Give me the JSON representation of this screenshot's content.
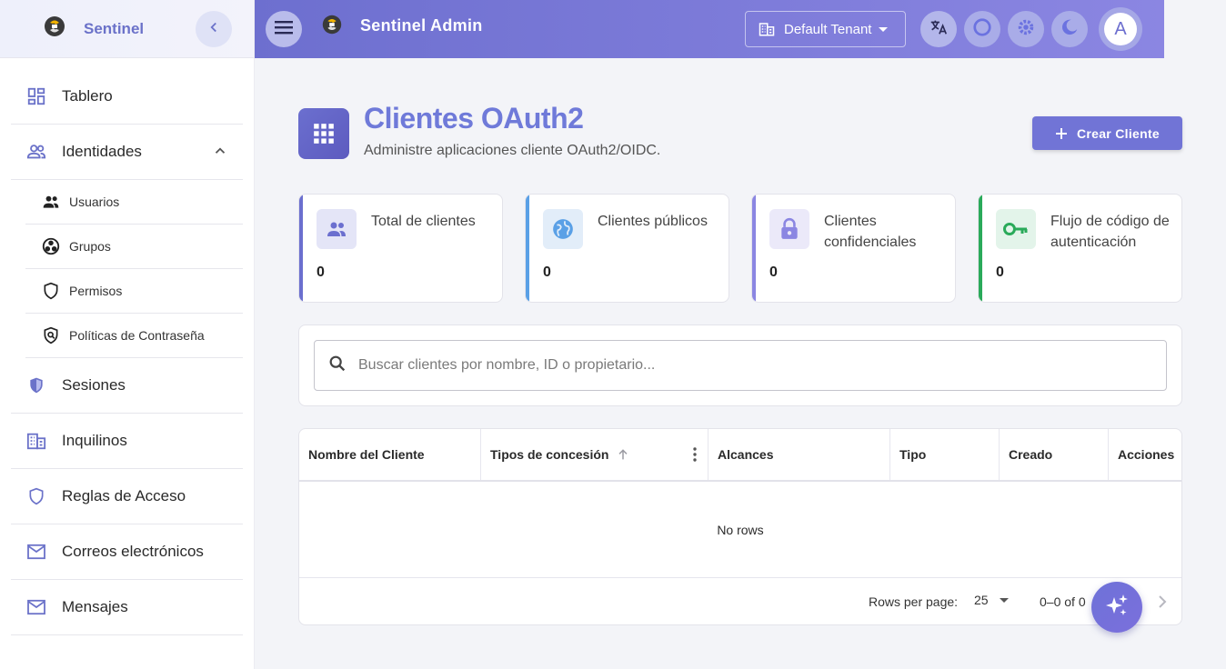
{
  "sidebar": {
    "brand": "Sentinel",
    "items": [
      {
        "label": "Tablero",
        "icon": "dashboard-icon"
      },
      {
        "label": "Identidades",
        "icon": "people-outline-icon",
        "expanded": true
      },
      {
        "label": "Sesiones",
        "icon": "shield-half-icon"
      },
      {
        "label": "Inquilinos",
        "icon": "building-icon"
      },
      {
        "label": "Reglas de Acceso",
        "icon": "shield-outline-icon"
      },
      {
        "label": "Correos electrónicos",
        "icon": "mail-icon"
      },
      {
        "label": "Mensajes",
        "icon": "mail-icon"
      }
    ],
    "sub_items": [
      {
        "label": "Usuarios",
        "icon": "people-icon"
      },
      {
        "label": "Grupos",
        "icon": "workspaces-icon"
      },
      {
        "label": "Permisos",
        "icon": "shield-outline-icon"
      },
      {
        "label": "Políticas de Contraseña",
        "icon": "policy-icon"
      }
    ]
  },
  "topbar": {
    "title": "Sentinel Admin",
    "tenant": "Default Tenant",
    "avatar_letter": "A"
  },
  "page": {
    "title": "Clientes OAuth2",
    "subtitle": "Administre aplicaciones cliente OAuth2/OIDC.",
    "create_button": "Crear Cliente"
  },
  "stats": [
    {
      "label": "Total de clientes",
      "value": "0",
      "color": "#6b6fcf"
    },
    {
      "label": "Clientes públicos",
      "value": "0",
      "color": "#5aa0e6"
    },
    {
      "label": "Clientes confidenciales",
      "value": "0",
      "color": "#8b86e2"
    },
    {
      "label": "Flujo de código de autenticación",
      "value": "0",
      "color": "#2aaa5a"
    }
  ],
  "search": {
    "placeholder": "Buscar clientes por nombre, ID o propietario..."
  },
  "table": {
    "columns": [
      "Nombre del Cliente",
      "Tipos de concesión",
      "Alcances",
      "Tipo",
      "Creado",
      "Acciones"
    ],
    "empty_text": "No rows",
    "rows_per_page_label": "Rows per page:",
    "rows_per_page": "25",
    "range": "0–0 of 0"
  },
  "colors": {
    "accent": "#6d6fcf",
    "topbar_end": "#8b86e2"
  }
}
